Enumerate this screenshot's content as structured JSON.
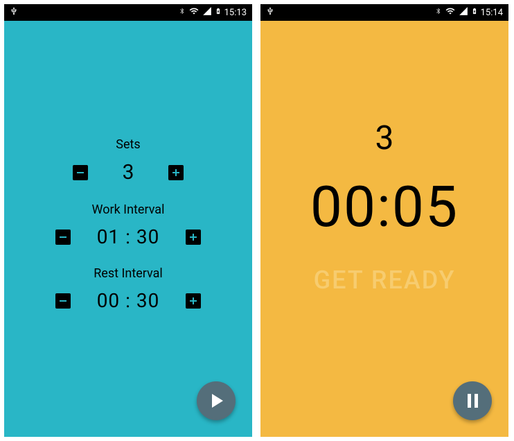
{
  "left": {
    "statusbar": {
      "time": "15:13"
    },
    "sets": {
      "label": "Sets",
      "value": "3"
    },
    "work": {
      "label": "Work Interval",
      "value": "01 : 30"
    },
    "rest": {
      "label": "Rest Interval",
      "value": "00 : 30"
    }
  },
  "right": {
    "statusbar": {
      "time": "15:14"
    },
    "countdown": {
      "sets": "3",
      "time": "00:05",
      "status": "GET READY"
    }
  }
}
